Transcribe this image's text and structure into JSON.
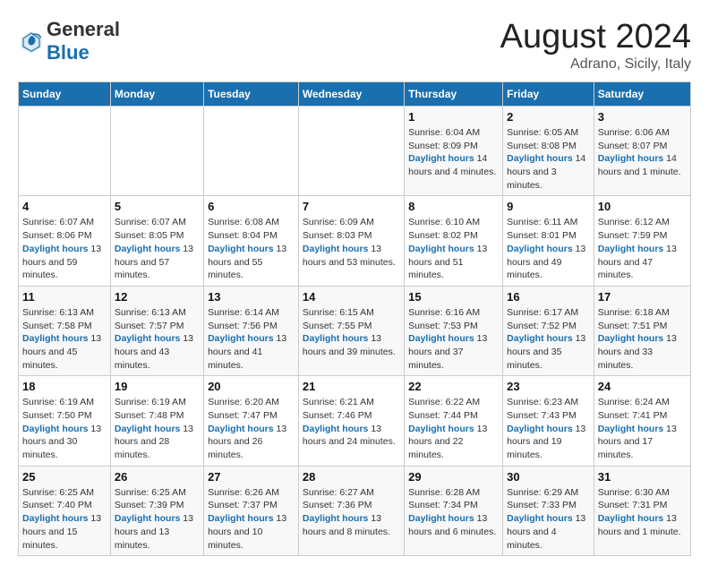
{
  "header": {
    "logo": {
      "general": "General",
      "blue": "Blue"
    },
    "title": "August 2024",
    "subtitle": "Adrano, Sicily, Italy"
  },
  "days_of_week": [
    "Sunday",
    "Monday",
    "Tuesday",
    "Wednesday",
    "Thursday",
    "Friday",
    "Saturday"
  ],
  "weeks": [
    [
      {
        "day": "",
        "sunrise": "",
        "sunset": "",
        "daylight": ""
      },
      {
        "day": "",
        "sunrise": "",
        "sunset": "",
        "daylight": ""
      },
      {
        "day": "",
        "sunrise": "",
        "sunset": "",
        "daylight": ""
      },
      {
        "day": "",
        "sunrise": "",
        "sunset": "",
        "daylight": ""
      },
      {
        "day": "1",
        "sunrise": "Sunrise: 6:04 AM",
        "sunset": "Sunset: 8:09 PM",
        "daylight": "Daylight: 14 hours and 4 minutes."
      },
      {
        "day": "2",
        "sunrise": "Sunrise: 6:05 AM",
        "sunset": "Sunset: 8:08 PM",
        "daylight": "Daylight: 14 hours and 3 minutes."
      },
      {
        "day": "3",
        "sunrise": "Sunrise: 6:06 AM",
        "sunset": "Sunset: 8:07 PM",
        "daylight": "Daylight: 14 hours and 1 minute."
      }
    ],
    [
      {
        "day": "4",
        "sunrise": "Sunrise: 6:07 AM",
        "sunset": "Sunset: 8:06 PM",
        "daylight": "Daylight: 13 hours and 59 minutes."
      },
      {
        "day": "5",
        "sunrise": "Sunrise: 6:07 AM",
        "sunset": "Sunset: 8:05 PM",
        "daylight": "Daylight: 13 hours and 57 minutes."
      },
      {
        "day": "6",
        "sunrise": "Sunrise: 6:08 AM",
        "sunset": "Sunset: 8:04 PM",
        "daylight": "Daylight: 13 hours and 55 minutes."
      },
      {
        "day": "7",
        "sunrise": "Sunrise: 6:09 AM",
        "sunset": "Sunset: 8:03 PM",
        "daylight": "Daylight: 13 hours and 53 minutes."
      },
      {
        "day": "8",
        "sunrise": "Sunrise: 6:10 AM",
        "sunset": "Sunset: 8:02 PM",
        "daylight": "Daylight: 13 hours and 51 minutes."
      },
      {
        "day": "9",
        "sunrise": "Sunrise: 6:11 AM",
        "sunset": "Sunset: 8:01 PM",
        "daylight": "Daylight: 13 hours and 49 minutes."
      },
      {
        "day": "10",
        "sunrise": "Sunrise: 6:12 AM",
        "sunset": "Sunset: 7:59 PM",
        "daylight": "Daylight: 13 hours and 47 minutes."
      }
    ],
    [
      {
        "day": "11",
        "sunrise": "Sunrise: 6:13 AM",
        "sunset": "Sunset: 7:58 PM",
        "daylight": "Daylight: 13 hours and 45 minutes."
      },
      {
        "day": "12",
        "sunrise": "Sunrise: 6:13 AM",
        "sunset": "Sunset: 7:57 PM",
        "daylight": "Daylight: 13 hours and 43 minutes."
      },
      {
        "day": "13",
        "sunrise": "Sunrise: 6:14 AM",
        "sunset": "Sunset: 7:56 PM",
        "daylight": "Daylight: 13 hours and 41 minutes."
      },
      {
        "day": "14",
        "sunrise": "Sunrise: 6:15 AM",
        "sunset": "Sunset: 7:55 PM",
        "daylight": "Daylight: 13 hours and 39 minutes."
      },
      {
        "day": "15",
        "sunrise": "Sunrise: 6:16 AM",
        "sunset": "Sunset: 7:53 PM",
        "daylight": "Daylight: 13 hours and 37 minutes."
      },
      {
        "day": "16",
        "sunrise": "Sunrise: 6:17 AM",
        "sunset": "Sunset: 7:52 PM",
        "daylight": "Daylight: 13 hours and 35 minutes."
      },
      {
        "day": "17",
        "sunrise": "Sunrise: 6:18 AM",
        "sunset": "Sunset: 7:51 PM",
        "daylight": "Daylight: 13 hours and 33 minutes."
      }
    ],
    [
      {
        "day": "18",
        "sunrise": "Sunrise: 6:19 AM",
        "sunset": "Sunset: 7:50 PM",
        "daylight": "Daylight: 13 hours and 30 minutes."
      },
      {
        "day": "19",
        "sunrise": "Sunrise: 6:19 AM",
        "sunset": "Sunset: 7:48 PM",
        "daylight": "Daylight: 13 hours and 28 minutes."
      },
      {
        "day": "20",
        "sunrise": "Sunrise: 6:20 AM",
        "sunset": "Sunset: 7:47 PM",
        "daylight": "Daylight: 13 hours and 26 minutes."
      },
      {
        "day": "21",
        "sunrise": "Sunrise: 6:21 AM",
        "sunset": "Sunset: 7:46 PM",
        "daylight": "Daylight: 13 hours and 24 minutes."
      },
      {
        "day": "22",
        "sunrise": "Sunrise: 6:22 AM",
        "sunset": "Sunset: 7:44 PM",
        "daylight": "Daylight: 13 hours and 22 minutes."
      },
      {
        "day": "23",
        "sunrise": "Sunrise: 6:23 AM",
        "sunset": "Sunset: 7:43 PM",
        "daylight": "Daylight: 13 hours and 19 minutes."
      },
      {
        "day": "24",
        "sunrise": "Sunrise: 6:24 AM",
        "sunset": "Sunset: 7:41 PM",
        "daylight": "Daylight: 13 hours and 17 minutes."
      }
    ],
    [
      {
        "day": "25",
        "sunrise": "Sunrise: 6:25 AM",
        "sunset": "Sunset: 7:40 PM",
        "daylight": "Daylight: 13 hours and 15 minutes."
      },
      {
        "day": "26",
        "sunrise": "Sunrise: 6:25 AM",
        "sunset": "Sunset: 7:39 PM",
        "daylight": "Daylight: 13 hours and 13 minutes."
      },
      {
        "day": "27",
        "sunrise": "Sunrise: 6:26 AM",
        "sunset": "Sunset: 7:37 PM",
        "daylight": "Daylight: 13 hours and 10 minutes."
      },
      {
        "day": "28",
        "sunrise": "Sunrise: 6:27 AM",
        "sunset": "Sunset: 7:36 PM",
        "daylight": "Daylight: 13 hours and 8 minutes."
      },
      {
        "day": "29",
        "sunrise": "Sunrise: 6:28 AM",
        "sunset": "Sunset: 7:34 PM",
        "daylight": "Daylight: 13 hours and 6 minutes."
      },
      {
        "day": "30",
        "sunrise": "Sunrise: 6:29 AM",
        "sunset": "Sunset: 7:33 PM",
        "daylight": "Daylight: 13 hours and 4 minutes."
      },
      {
        "day": "31",
        "sunrise": "Sunrise: 6:30 AM",
        "sunset": "Sunset: 7:31 PM",
        "daylight": "Daylight: 13 hours and 1 minute."
      }
    ]
  ]
}
